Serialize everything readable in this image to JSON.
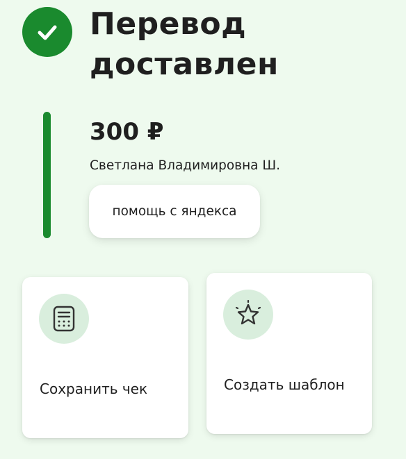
{
  "header": {
    "status_icon": "check-icon",
    "title": "Перевод доставлен"
  },
  "transfer": {
    "amount": "300 ₽",
    "recipient": "Светлана Владимировна Ш.",
    "message": "помощь с яндекса"
  },
  "actions": [
    {
      "icon": "receipt-icon",
      "label": "Сохранить чек"
    },
    {
      "icon": "star-icon",
      "label": "Создать шаблон"
    }
  ],
  "colors": {
    "background": "#eefaee",
    "accent": "#1a8a2e",
    "icon_circle": "#d9eedd",
    "text": "#1f1f1f"
  }
}
